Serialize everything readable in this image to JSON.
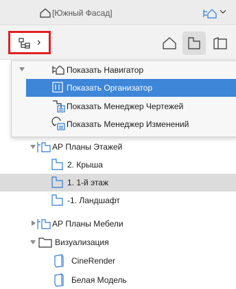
{
  "header": {
    "view_title": "[Южный Фасад]"
  },
  "toolbar": {
    "navigator_switch_chevron": "›"
  },
  "menu": {
    "items": [
      {
        "label": "Показать Навигатор",
        "selected": false
      },
      {
        "label": "Показать Организатор",
        "selected": true
      },
      {
        "label": "Показать Менеджер Чертежей",
        "selected": false
      },
      {
        "label": "Показать Менеджер Изменений",
        "selected": false
      }
    ]
  },
  "tree": {
    "floor_plans": {
      "label": "АР Планы Этажей",
      "children": [
        "2. Крыша",
        "1. 1-й этаж",
        "-1. Ландшафт"
      ],
      "selected_child": "1. 1-й этаж"
    },
    "furniture_plans": {
      "label": "АР Планы Мебели"
    },
    "visualization": {
      "label": "Визуализация",
      "children": [
        "CineRender",
        "Белая Модель"
      ]
    }
  },
  "colors": {
    "accent": "#3d86d8",
    "highlight_row": "#dcdcdc",
    "red_outline": "#e02020",
    "icon_blue": "#2d7bd6"
  }
}
